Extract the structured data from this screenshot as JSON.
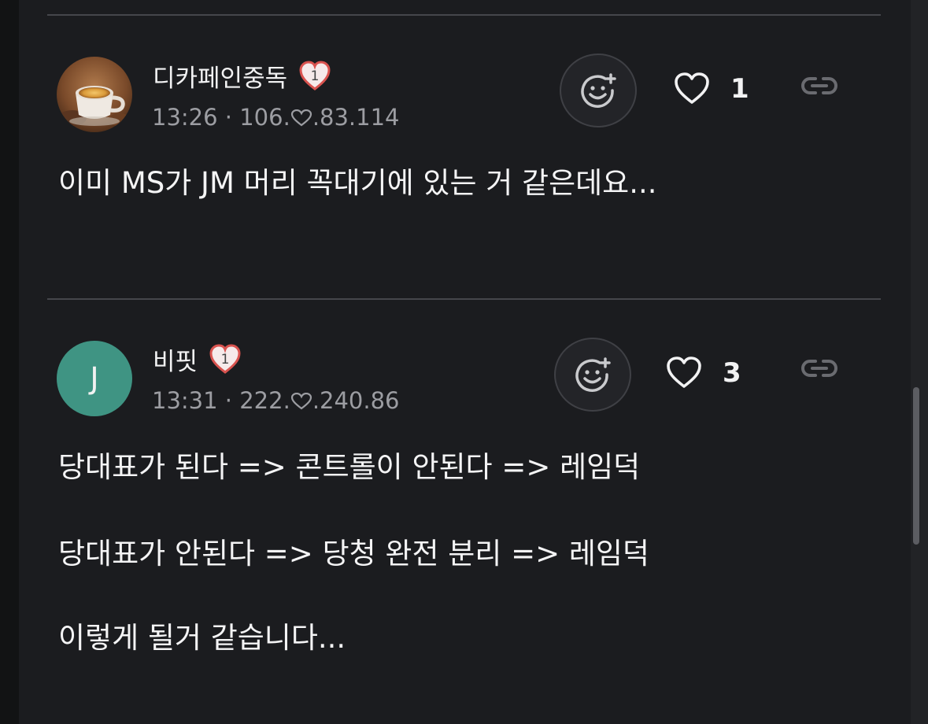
{
  "comments": [
    {
      "nickname": "디카페인중독",
      "level_badge": "1",
      "time": "13:26",
      "separator": "·",
      "ip_prefix": "106.",
      "ip_suffix": ".83.114",
      "likes": "1",
      "avatar_letter": "",
      "avatar_kind": "coffee-cup-photo",
      "body": [
        "이미 MS가 JM 머리 꼭대기에 있는 거 같은데요..."
      ]
    },
    {
      "nickname": "비핏",
      "level_badge": "1",
      "time": "13:31",
      "separator": "·",
      "ip_prefix": "222.",
      "ip_suffix": ".240.86",
      "likes": "3",
      "avatar_letter": "J",
      "avatar_kind": "letter",
      "avatar_color": "#3f9483",
      "body": [
        "당대표가 된다 => 콘트롤이 안된다 => 레임덕",
        "당대표가 안된다 => 당청 완전 분리 => 레임덕",
        "이렇게 될거 같습니다..."
      ]
    }
  ],
  "icons": {
    "react": "emoji-add-icon",
    "like": "heart-outline-icon",
    "link": "link-icon",
    "ip_mask": "heart-outline-icon",
    "badge": "level-heart-badge-icon"
  },
  "colors": {
    "background": "#1b1c1f",
    "divider": "#45464b",
    "meta_text": "#9c9da2",
    "badge_red": "#d9534f",
    "avatar_green": "#3f9483"
  }
}
